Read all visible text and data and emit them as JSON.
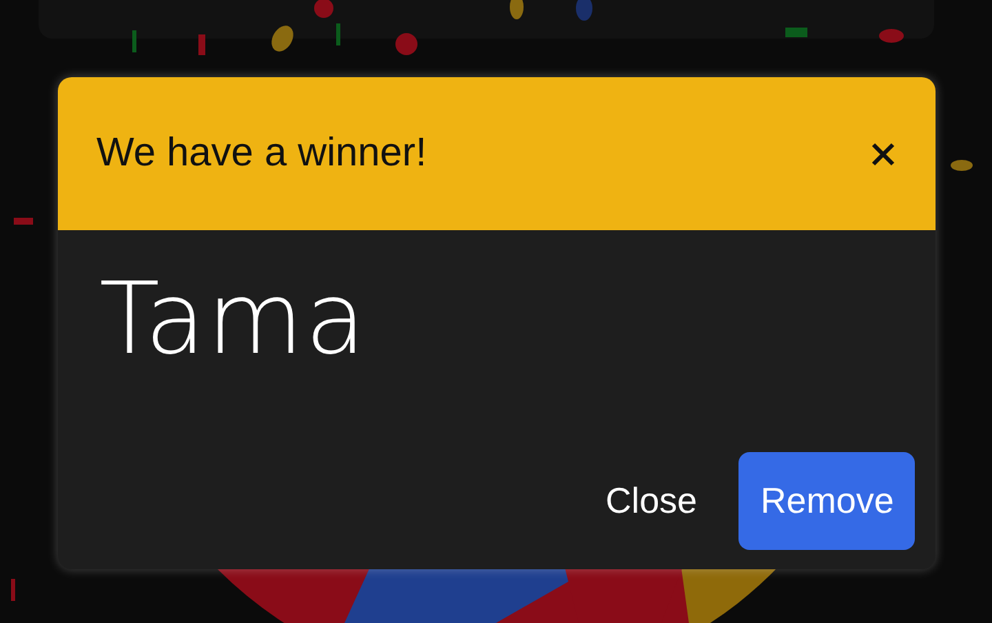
{
  "dialog": {
    "title": "We have a winner!",
    "winner": "Tama",
    "buttons": [
      {
        "label": "Close",
        "kind": "text"
      },
      {
        "label": "Remove",
        "kind": "primary"
      }
    ]
  }
}
